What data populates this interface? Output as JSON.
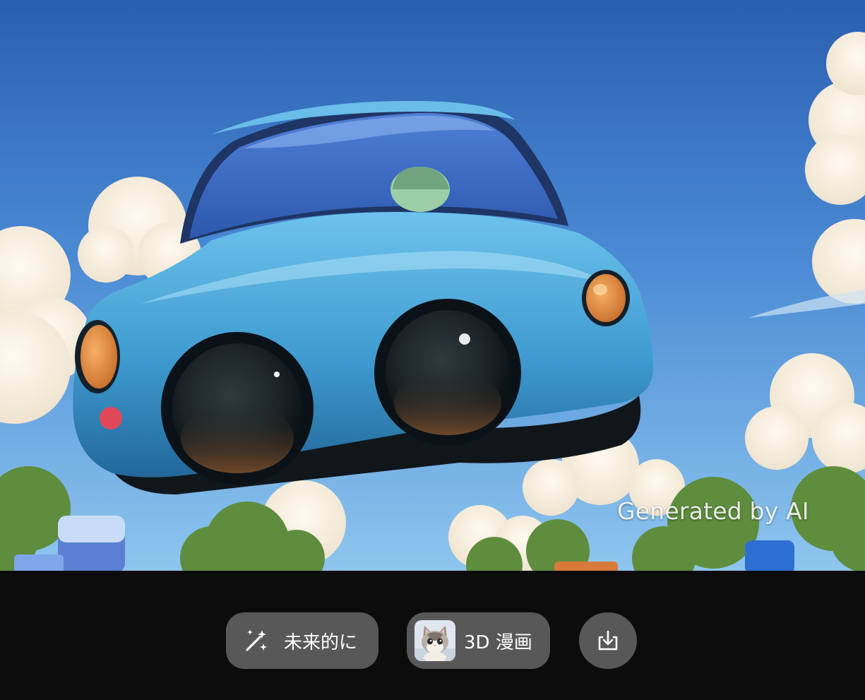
{
  "image": {
    "watermark": "Generated by AI",
    "subject_icon": "blue-flying-car-illustration"
  },
  "toolbar": {
    "style_futuristic": {
      "label": "未来的に",
      "icon": "sparkle-wand-icon"
    },
    "style_3d_manga": {
      "label": "3D 漫画",
      "icon": "cat-thumbnail"
    },
    "download": {
      "icon": "download-icon"
    }
  },
  "colors": {
    "toolbar_background": "#0c0c0c",
    "button_background": "#585858",
    "button_text": "#ffffff"
  }
}
